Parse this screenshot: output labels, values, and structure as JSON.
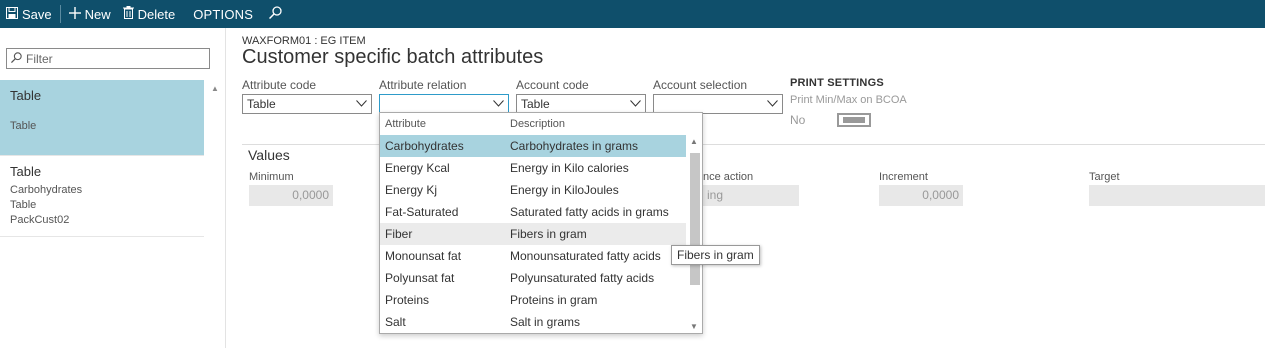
{
  "toolbar": {
    "save_label": "Save",
    "new_label": "New",
    "delete_label": "Delete",
    "options_label": "OPTIONS"
  },
  "leftpane": {
    "filter_placeholder": "Filter",
    "items": [
      {
        "title": "Table",
        "sub": [
          "Table"
        ]
      },
      {
        "title": "Table",
        "sub": [
          "Carbohydrates",
          "Table",
          "PackCust02"
        ]
      }
    ]
  },
  "main": {
    "breadcrumb": "WAXFORM01 : EG ITEM",
    "title": "Customer specific batch attributes",
    "fields": {
      "attribute_code": {
        "label": "Attribute code",
        "value": "Table"
      },
      "attribute_relation": {
        "label": "Attribute relation",
        "value": ""
      },
      "account_code": {
        "label": "Account code",
        "value": "Table"
      },
      "account_selection": {
        "label": "Account selection",
        "value": ""
      }
    },
    "print_settings": {
      "heading": "PRINT SETTINGS",
      "label": "Print Min/Max on BCOA",
      "value": "No"
    },
    "values": {
      "heading": "Values",
      "minimum_label": "Minimum",
      "minimum_value": "0,0000",
      "tolerance_action_label": "nce action",
      "tolerance_action_value": "ing",
      "increment_label": "Increment",
      "increment_value": "0,0000",
      "target_label": "Target",
      "target_value": ""
    }
  },
  "dropdown": {
    "col_attribute": "Attribute",
    "col_description": "Description",
    "rows": [
      {
        "attribute": "Carbohydrates",
        "description": "Carbohydrates in grams"
      },
      {
        "attribute": "Energy Kcal",
        "description": "Energy in Kilo calories"
      },
      {
        "attribute": "Energy Kj",
        "description": "Energy in KiloJoules"
      },
      {
        "attribute": "Fat-Saturated",
        "description": "Saturated fatty acids in grams"
      },
      {
        "attribute": "Fiber",
        "description": "Fibers in gram"
      },
      {
        "attribute": "Monounsat fat",
        "description": "Monounsaturated fatty acids"
      },
      {
        "attribute": "Polyunsat fat",
        "description": "Polyunsaturated fatty acids"
      },
      {
        "attribute": "Proteins",
        "description": "Proteins in gram"
      },
      {
        "attribute": "Salt",
        "description": "Salt in grams"
      }
    ],
    "tooltip": "Fibers in gram"
  },
  "colors": {
    "topbar": "#0f4f6b",
    "selected": "#a8d3df",
    "focus_border": "#2e9bc9"
  }
}
